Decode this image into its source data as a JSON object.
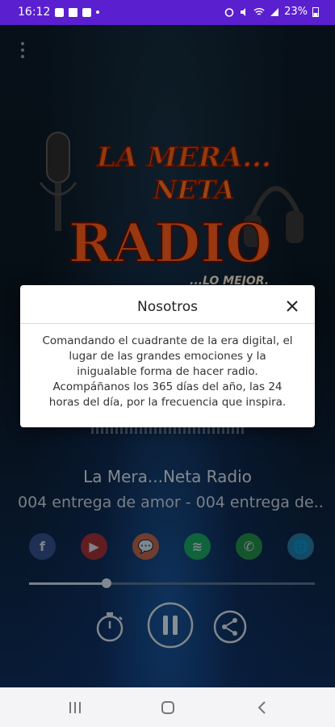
{
  "status_bar": {
    "time": "16:12",
    "battery": "23%"
  },
  "dialog": {
    "title": "Nosotros",
    "body": "Comandando el cuadrante de la era digital, el lugar de las grandes emociones y la inigualable forma de hacer radio. Acompáñanos los 365 días del año, las 24 horas del día, por la frecuencia que inspira."
  },
  "logo": {
    "line1": "LA MERA...",
    "line2": "NETA",
    "line3": "RADIO",
    "tagline": "...LO MEJOR."
  },
  "player": {
    "station_name": "La Mera...Neta Radio",
    "track_title": "004 entrega de amor - 004 entrega de..",
    "progress": 0.27
  },
  "social": [
    {
      "name": "facebook",
      "glyph": "f",
      "color": "#3b5998"
    },
    {
      "name": "youtube",
      "glyph": "▶",
      "color": "#c4302b"
    },
    {
      "name": "chat",
      "glyph": "💬",
      "color": "#e06a3a"
    },
    {
      "name": "spotify",
      "glyph": "≋",
      "color": "#1db954"
    },
    {
      "name": "whatsapp",
      "glyph": "✆",
      "color": "#25a244"
    },
    {
      "name": "website",
      "glyph": "🌐",
      "color": "#2a8ab5"
    }
  ],
  "colors": {
    "accent": "#5a1fcf",
    "dialog_bg": "#ffffff"
  }
}
